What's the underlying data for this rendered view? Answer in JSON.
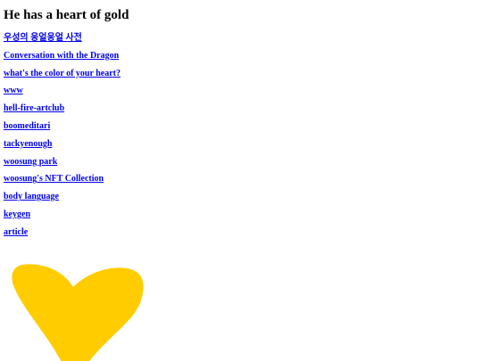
{
  "page": {
    "heading": "He has a heart of gold"
  },
  "links": [
    {
      "label": "우성의 웅얼웅얼 사전"
    },
    {
      "label": "Conversation with the Dragon"
    },
    {
      "label": "what's the color of your heart?"
    },
    {
      "label": "www"
    },
    {
      "label": "hell-fire-artclub"
    },
    {
      "label": "boomeditari"
    },
    {
      "label": "tackyenough"
    },
    {
      "label": "woosung park"
    },
    {
      "label": "woosung's NFT Collection"
    },
    {
      "label": "body language"
    },
    {
      "label": "keygen"
    },
    {
      "label": "article"
    }
  ],
  "heart": {
    "icon": "heart-icon",
    "color": "#FFCC00"
  },
  "colors": {
    "link": "#0000EE",
    "heading": "#000000",
    "background": "#FFFFFF"
  }
}
